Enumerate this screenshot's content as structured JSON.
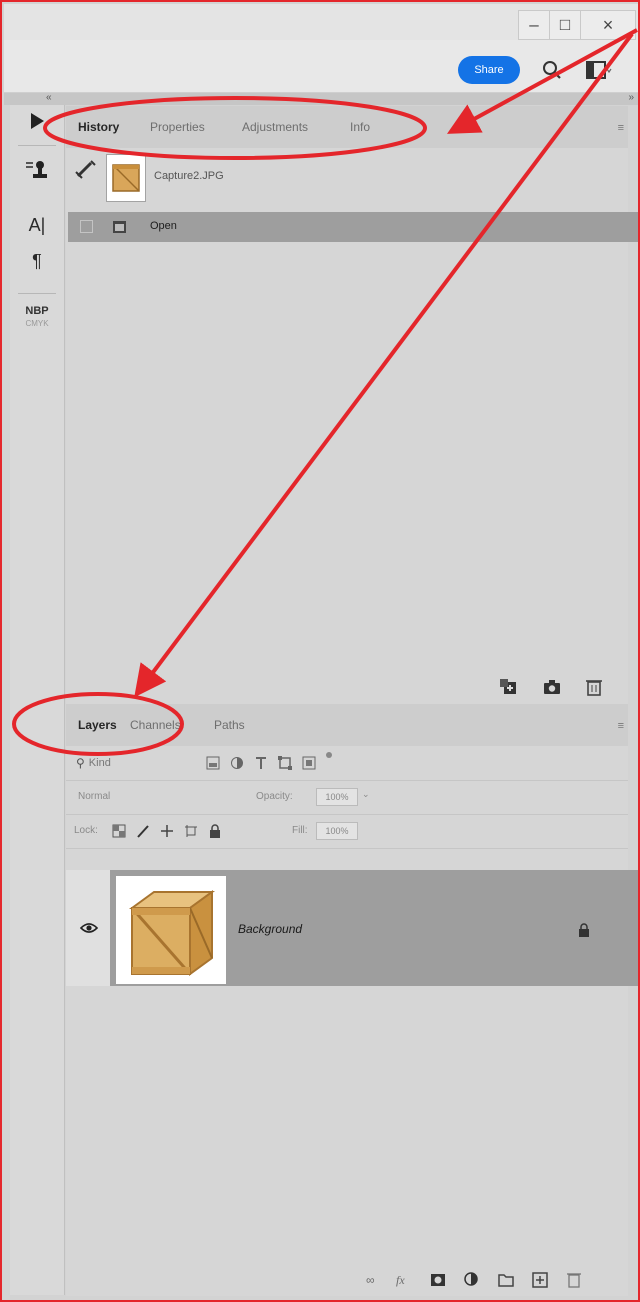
{
  "window": {
    "minimize": "–",
    "maximize": "□",
    "close": "×"
  },
  "toolbar": {
    "share_label": "Share"
  },
  "collapse": {
    "left": "«",
    "right": "»"
  },
  "left_dock": {
    "type_icon_label": "A|",
    "paragraph_icon_label": "¶",
    "nbp_label": "NBP",
    "cmyk_label": "CMYK"
  },
  "history_panel": {
    "tabs": [
      "History",
      "Properties",
      "Adjustments",
      "Info"
    ],
    "active_tab": "History",
    "menu_icon": "≡",
    "snapshot_name": "Capture2.JPG",
    "steps": [
      "Open"
    ]
  },
  "layers_panel": {
    "tabs": [
      "Layers",
      "Channels",
      "Paths"
    ],
    "active_tab": "Layers",
    "menu_icon": "≡",
    "filter_placeholder": "Kind",
    "blend_mode": "Normal",
    "opacity_label": "Opacity:",
    "opacity_value": "100%",
    "lock_label": "Lock:",
    "fill_label": "Fill:",
    "fill_value": "100%",
    "layers": [
      {
        "name": "Background",
        "visible": true,
        "locked": true
      }
    ],
    "footer_link": "∞",
    "footer_fx": "fx"
  },
  "colors": {
    "accent": "#1473e6",
    "annotation": "#e4262b",
    "selected_row": "#9e9e9e"
  }
}
